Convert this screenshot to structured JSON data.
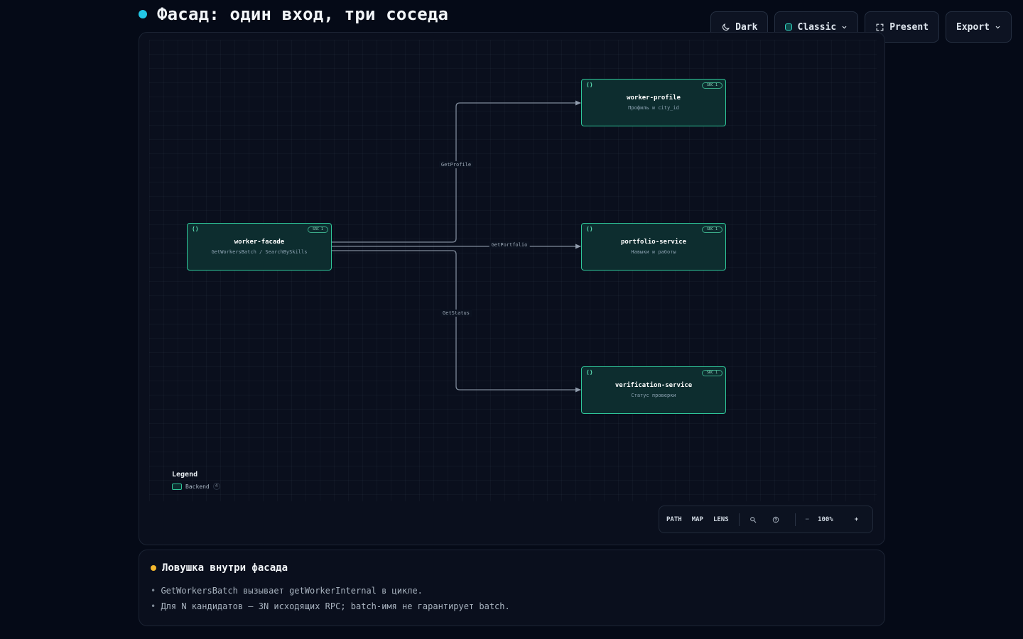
{
  "header": {
    "title": "Фасад: один вход, три соседа"
  },
  "toolbar": {
    "theme_label": "Dark",
    "style_label": "Classic",
    "present_label": "Present",
    "export_label": "Export"
  },
  "diagram": {
    "nodes": [
      {
        "id": "worker-facade",
        "title": "worker-facade",
        "subtitle": "GetWorkersBatch / SearchBySkills",
        "badge": "SRC 1",
        "icon": "code-braces-icon"
      },
      {
        "id": "worker-profile",
        "title": "worker-profile",
        "subtitle": "Профиль и city_id",
        "badge": "SRC 1",
        "icon": "code-braces-icon"
      },
      {
        "id": "portfolio-service",
        "title": "portfolio-service",
        "subtitle": "Навыки и работы",
        "badge": "SRC 1",
        "icon": "code-braces-icon"
      },
      {
        "id": "verification-service",
        "title": "verification-service",
        "subtitle": "Статус проверки",
        "badge": "SRC 1",
        "icon": "code-braces-icon"
      }
    ],
    "edges": [
      {
        "from": "worker-facade",
        "to": "worker-profile",
        "label": "GetProfile"
      },
      {
        "from": "worker-facade",
        "to": "portfolio-service",
        "label": "GetPortfolio"
      },
      {
        "from": "worker-facade",
        "to": "verification-service",
        "label": "GetStatus"
      }
    ],
    "icon_glyph": "⟨⟩"
  },
  "legend": {
    "title": "Legend",
    "items": [
      {
        "label": "Backend",
        "count": "4",
        "color": "#2fc79a"
      }
    ]
  },
  "controls": {
    "path_label": "PATH",
    "map_label": "MAP",
    "lens_label": "LENS",
    "zoom_out_label": "−",
    "zoom_level": "100%",
    "zoom_in_label": "+"
  },
  "note": {
    "title": "Ловушка внутри фасада",
    "items": [
      "GetWorkersBatch вызывает getWorkerInternal в цикле.",
      "Для N кандидатов — 3N исходящих RPC; batch-имя не гарантирует batch."
    ]
  },
  "colors": {
    "accent_title_dot": "#22c7e6",
    "node_border": "#2fc79a",
    "node_fill": "#0d2d2f",
    "note_dot": "#f5b82e"
  }
}
